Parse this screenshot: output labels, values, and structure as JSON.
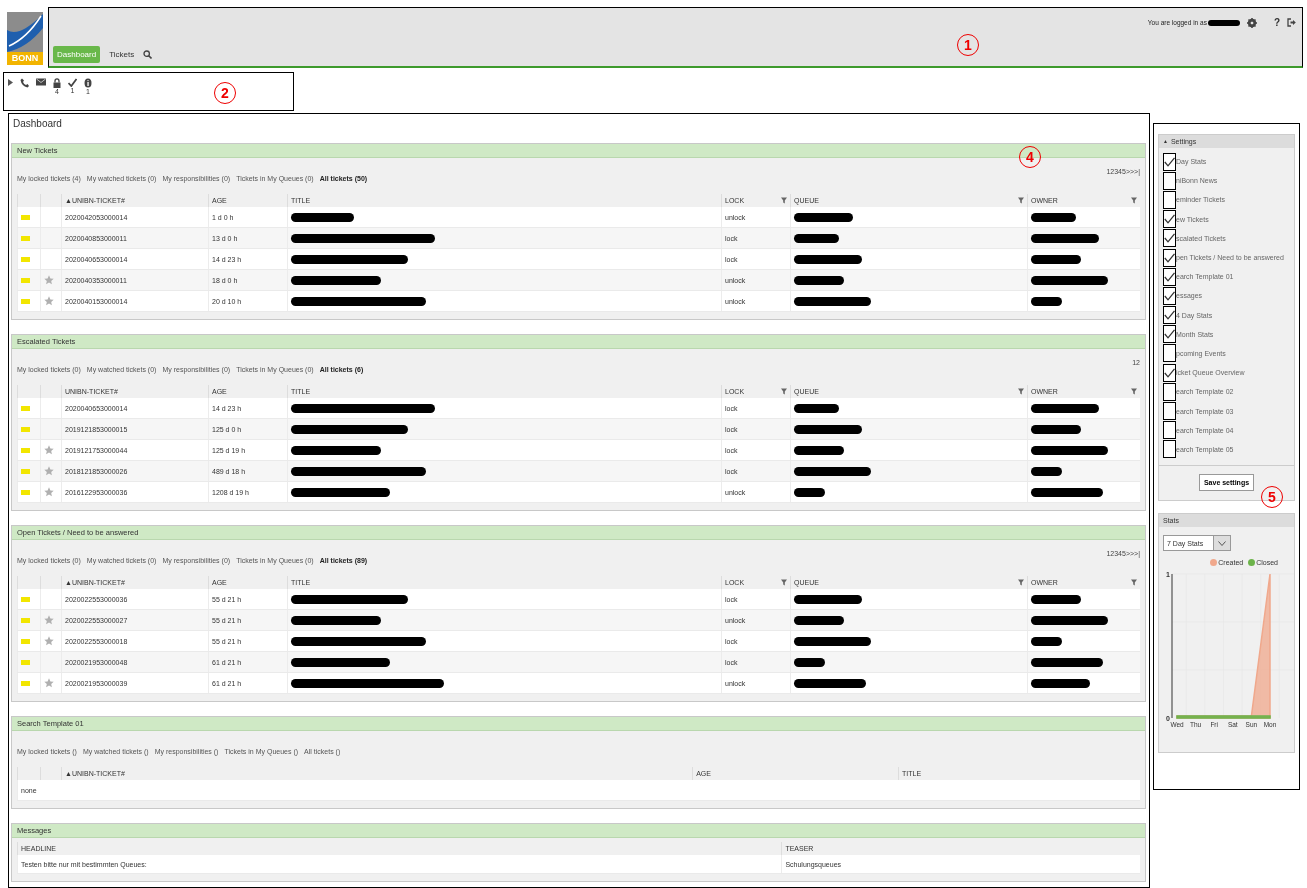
{
  "logo": {
    "text": "BONN"
  },
  "user": {
    "prefix": "You are logged in as",
    "name_redacted": true,
    "help": "?"
  },
  "nav": [
    {
      "label": "Dashboard",
      "selected": true
    },
    {
      "label": "Tickets",
      "selected": false
    }
  ],
  "toolbar": [
    {
      "kind": "expand"
    },
    {
      "kind": "phone"
    },
    {
      "kind": "mail"
    },
    {
      "kind": "lock",
      "count": "4"
    },
    {
      "kind": "check",
      "count": "1"
    },
    {
      "kind": "info",
      "count": "1"
    }
  ],
  "page_title": "Dashboard",
  "widgets": [
    {
      "kind": "tickets",
      "title": "New Tickets",
      "pager": "12345>>>|",
      "filters": [
        {
          "label": "My locked tickets (4)",
          "selected": false
        },
        {
          "label": "My watched tickets (0)",
          "selected": false
        },
        {
          "label": "My responsibilities (0)",
          "selected": false
        },
        {
          "label": "Tickets in My Queues (0)",
          "selected": false
        },
        {
          "label": "All tickets (50)",
          "selected": true
        }
      ],
      "columns": [
        {
          "label": "▲UNIBN-TICKET#"
        },
        {
          "label": "AGE"
        },
        {
          "label": "TITLE"
        },
        {
          "label": "LOCK",
          "filter": true
        },
        {
          "label": "QUEUE",
          "filter": true
        },
        {
          "label": "OWNER",
          "filter": true
        }
      ],
      "rows": [
        {
          "color": "#f2e600",
          "starred": false,
          "cells": [
            {
              "text": "2020042053000014"
            },
            {
              "text": "1 d 0 h"
            },
            {
              "redacted": true
            },
            {
              "text": "unlock"
            },
            {
              "redacted": true
            },
            {
              "redacted": true
            }
          ]
        },
        {
          "color": "#f2e600",
          "starred": false,
          "cells": [
            {
              "text": "2020040853000011"
            },
            {
              "text": "13 d 0 h"
            },
            {
              "redacted": true
            },
            {
              "text": "lock"
            },
            {
              "redacted": true
            },
            {
              "redacted": true
            }
          ]
        },
        {
          "color": "#f2e600",
          "starred": false,
          "cells": [
            {
              "text": "2020040653000014"
            },
            {
              "text": "14 d 23 h"
            },
            {
              "redacted": true
            },
            {
              "text": "lock"
            },
            {
              "redacted": true
            },
            {
              "redacted": true
            }
          ]
        },
        {
          "color": "#f2e600",
          "starred": true,
          "cells": [
            {
              "text": "2020040353000011"
            },
            {
              "text": "18 d 0 h"
            },
            {
              "redacted": true
            },
            {
              "text": "unlock"
            },
            {
              "redacted": true
            },
            {
              "redacted": true
            }
          ]
        },
        {
          "color": "#f2e600",
          "starred": true,
          "cells": [
            {
              "text": "2020040153000014"
            },
            {
              "text": "20 d 10 h"
            },
            {
              "redacted": true
            },
            {
              "text": "unlock"
            },
            {
              "redacted": true
            },
            {
              "redacted": true
            }
          ]
        }
      ]
    },
    {
      "kind": "tickets",
      "title": "Escalated Tickets",
      "pager": "12",
      "filters": [
        {
          "label": "My locked tickets (0)",
          "selected": false
        },
        {
          "label": "My watched tickets (0)",
          "selected": false
        },
        {
          "label": "My responsibilities (0)",
          "selected": false
        },
        {
          "label": "Tickets in My Queues (0)",
          "selected": false
        },
        {
          "label": "All tickets (6)",
          "selected": true
        }
      ],
      "columns": [
        {
          "label": "UNIBN-TICKET#"
        },
        {
          "label": "AGE"
        },
        {
          "label": "TITLE"
        },
        {
          "label": "LOCK",
          "filter": true
        },
        {
          "label": "QUEUE",
          "filter": true
        },
        {
          "label": "OWNER",
          "filter": true
        }
      ],
      "rows": [
        {
          "color": "#f2e600",
          "starred": false,
          "cells": [
            {
              "text": "2020040653000014"
            },
            {
              "text": "14 d 23 h"
            },
            {
              "redacted": true
            },
            {
              "text": "lock"
            },
            {
              "redacted": true
            },
            {
              "redacted": true
            }
          ]
        },
        {
          "color": "#f2e600",
          "starred": false,
          "cells": [
            {
              "text": "2019121853000015"
            },
            {
              "text": "125 d 0 h"
            },
            {
              "redacted": true
            },
            {
              "text": "lock"
            },
            {
              "redacted": true
            },
            {
              "redacted": true
            }
          ]
        },
        {
          "color": "#f2e600",
          "starred": true,
          "cells": [
            {
              "text": "2019121753000044"
            },
            {
              "text": "125 d 19 h"
            },
            {
              "redacted": true
            },
            {
              "text": "lock"
            },
            {
              "redacted": true
            },
            {
              "redacted": true
            }
          ]
        },
        {
          "color": "#f2e600",
          "starred": true,
          "cells": [
            {
              "text": "2018121853000026"
            },
            {
              "text": "489 d 18 h"
            },
            {
              "redacted": true
            },
            {
              "text": "lock"
            },
            {
              "redacted": true
            },
            {
              "redacted": true
            }
          ]
        },
        {
          "color": "#f2e600",
          "starred": true,
          "cells": [
            {
              "text": "2016122953000036"
            },
            {
              "text": "1208 d 19 h"
            },
            {
              "redacted": true
            },
            {
              "text": "unlock"
            },
            {
              "redacted": true
            },
            {
              "redacted": true
            }
          ]
        }
      ]
    },
    {
      "kind": "tickets",
      "title": "Open Tickets / Need to be answered",
      "pager": "12345>>>|",
      "filters": [
        {
          "label": "My locked tickets (0)",
          "selected": false
        },
        {
          "label": "My watched tickets (0)",
          "selected": false
        },
        {
          "label": "My responsibilities (0)",
          "selected": false
        },
        {
          "label": "Tickets in My Queues (0)",
          "selected": false
        },
        {
          "label": "All tickets (89)",
          "selected": true
        }
      ],
      "columns": [
        {
          "label": "▲UNIBN-TICKET#"
        },
        {
          "label": "AGE"
        },
        {
          "label": "TITLE"
        },
        {
          "label": "LOCK",
          "filter": true
        },
        {
          "label": "QUEUE",
          "filter": true
        },
        {
          "label": "OWNER",
          "filter": true
        }
      ],
      "rows": [
        {
          "color": "#f2e600",
          "starred": false,
          "cells": [
            {
              "text": "2020022553000036"
            },
            {
              "text": "55 d 21 h"
            },
            {
              "redacted": true
            },
            {
              "text": "lock"
            },
            {
              "redacted": true
            },
            {
              "redacted": true
            }
          ]
        },
        {
          "color": "#f2e600",
          "starred": true,
          "cells": [
            {
              "text": "2020022553000027"
            },
            {
              "text": "55 d 21 h"
            },
            {
              "redacted": true
            },
            {
              "text": "unlock"
            },
            {
              "redacted": true
            },
            {
              "redacted": true
            }
          ]
        },
        {
          "color": "#f2e600",
          "starred": true,
          "cells": [
            {
              "text": "2020022553000018"
            },
            {
              "text": "55 d 21 h"
            },
            {
              "redacted": true
            },
            {
              "text": "lock"
            },
            {
              "redacted": true
            },
            {
              "redacted": true
            }
          ]
        },
        {
          "color": "#f2e600",
          "starred": false,
          "cells": [
            {
              "text": "2020021953000048"
            },
            {
              "text": "61 d 21 h"
            },
            {
              "redacted": true
            },
            {
              "text": "lock"
            },
            {
              "redacted": true
            },
            {
              "redacted": true
            }
          ]
        },
        {
          "color": "#f2e600",
          "starred": true,
          "cells": [
            {
              "text": "2020021953000039"
            },
            {
              "text": "61 d 21 h"
            },
            {
              "redacted": true
            },
            {
              "text": "unlock"
            },
            {
              "redacted": true
            },
            {
              "redacted": true
            }
          ]
        }
      ]
    },
    {
      "kind": "tickets",
      "title": "Search Template 01",
      "filters": [
        {
          "label": "My locked tickets ()",
          "selected": false
        },
        {
          "label": "My watched tickets ()",
          "selected": false
        },
        {
          "label": "My responsibilities ()",
          "selected": false
        },
        {
          "label": "Tickets in My Queues ()",
          "selected": false
        },
        {
          "label": "All tickets ()",
          "selected": false
        }
      ],
      "columns": [
        {
          "label": "▲UNIBN-TICKET#"
        },
        {
          "label": "AGE"
        },
        {
          "label": "TITLE"
        }
      ],
      "empty_text": "none"
    },
    {
      "kind": "messages",
      "title": "Messages",
      "columns": [
        {
          "label": "HEADLINE"
        },
        {
          "label": "TEASER"
        }
      ],
      "rows": [
        {
          "cells": [
            {
              "text": "Testen bitte nur mit bestimmten Queues:"
            },
            {
              "text": "Schulungsqueues"
            }
          ]
        }
      ]
    }
  ],
  "settings": {
    "toggle": "▲",
    "title": "Settings",
    "button": "Save settings",
    "items": [
      {
        "label": "Day Stats",
        "checked": true
      },
      {
        "label": "niBonn News",
        "checked": false
      },
      {
        "label": "eminder Tickets",
        "checked": false
      },
      {
        "label": "ew Tickets",
        "checked": true
      },
      {
        "label": "scalated Tickets",
        "checked": true
      },
      {
        "label": "pen Tickets / Need to be answered",
        "checked": true
      },
      {
        "label": "earch Template 01",
        "checked": true
      },
      {
        "label": "essages",
        "checked": true
      },
      {
        "label": "4 Day Stats",
        "checked": true
      },
      {
        "label": "Month Stats",
        "checked": true
      },
      {
        "label": "pcoming Events",
        "checked": false
      },
      {
        "label": "icket Queue Overview",
        "checked": true
      },
      {
        "label": "earch Template 02",
        "checked": false
      },
      {
        "label": "earch Template 03",
        "checked": false
      },
      {
        "label": "earch Template 04",
        "checked": false
      },
      {
        "label": "earch Template 05",
        "checked": false
      }
    ]
  },
  "stats": {
    "title": "Stats",
    "select": "7 Day Stats",
    "chart_data": {
      "type": "area",
      "categories": [
        "Wed",
        "Thu",
        "Fri",
        "Sat",
        "Sun",
        "Mon"
      ],
      "yticks": [
        0,
        1
      ],
      "ylim": [
        0,
        1
      ],
      "series": [
        {
          "name": "Created",
          "color": "#f0a88c",
          "values": [
            0,
            0,
            0,
            0,
            0,
            1
          ]
        },
        {
          "name": "Closed",
          "color": "#6cb34a",
          "values": [
            0,
            0,
            0,
            0,
            0,
            0
          ]
        }
      ]
    }
  },
  "annotations": [
    {
      "label": "1"
    },
    {
      "label": "2"
    },
    {
      "label": "4"
    },
    {
      "label": "5"
    }
  ]
}
